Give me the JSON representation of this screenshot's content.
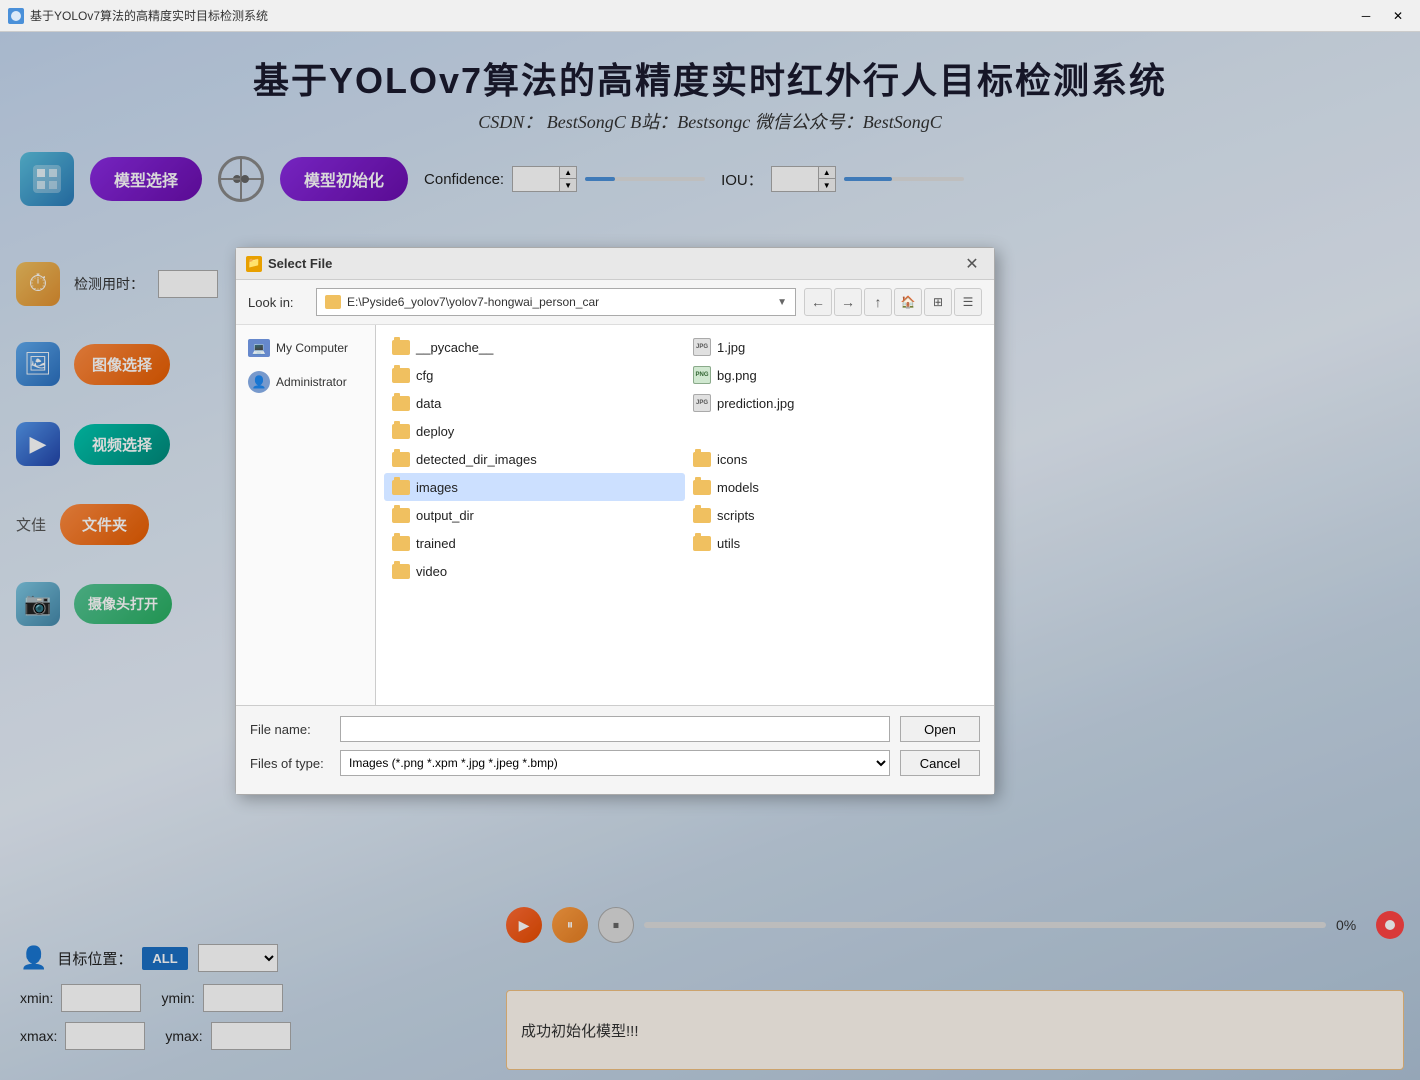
{
  "titleBar": {
    "title": "基于YOLOv7算法的高精度实时目标检测系统",
    "minimizeLabel": "─",
    "closeLabel": "✕"
  },
  "header": {
    "title": "基于YOLOv7算法的高精度实时红外行人目标检测系统",
    "subtitle": "CSDN： BestSongC    B站：Bestsongc    微信公众号：BestSongC"
  },
  "toolbar": {
    "modelSelectLabel": "模型选择",
    "modelInitLabel": "模型初始化",
    "confidenceLabel": "Confidence:",
    "confidenceValue": "0.25",
    "iouLabel": "IOU：",
    "iouValue": "0.40",
    "confidencePercent": 25,
    "iouPercent": 40
  },
  "sidebar": {
    "detectTimeLabel": "检测用时：",
    "imageSelectLabel": "图像选择",
    "videoSelectLabel": "视频选择",
    "folderLabel": "文件夹",
    "folderBtnLabel": "文件夹",
    "cameraLabel": "摄像头打开"
  },
  "targetPos": {
    "label": "目标位置：",
    "allLabel": "ALL",
    "xminLabel": "xmin:",
    "yminLabel": "ymin:",
    "xmaxLabel": "xmax:",
    "ymaxLabel": "ymax:"
  },
  "progressBar": {
    "percent": "0%"
  },
  "statusBar": {
    "message": "成功初始化模型!!!"
  },
  "fileDialog": {
    "title": "Select File",
    "lookInLabel": "Look in:",
    "lookInPath": "E:\\Pyside6_yolov7\\yolov7-hongwai_person_car",
    "places": [
      {
        "name": "My Computer",
        "type": "computer"
      },
      {
        "name": "Administrator",
        "type": "user"
      }
    ],
    "files": [
      {
        "name": "__pycache__",
        "type": "folder"
      },
      {
        "name": "1.jpg",
        "type": "jpg"
      },
      {
        "name": "cfg",
        "type": "folder"
      },
      {
        "name": "bg.png",
        "type": "png"
      },
      {
        "name": "data",
        "type": "folder"
      },
      {
        "name": "prediction.jpg",
        "type": "jpg"
      },
      {
        "name": "deploy",
        "type": "folder"
      },
      {
        "name": "detected_dir_images",
        "type": "folder"
      },
      {
        "name": "icons",
        "type": "folder"
      },
      {
        "name": "images",
        "type": "folder",
        "selected": true
      },
      {
        "name": "models",
        "type": "folder"
      },
      {
        "name": "output_dir",
        "type": "folder"
      },
      {
        "name": "scripts",
        "type": "folder"
      },
      {
        "name": "trained",
        "type": "folder"
      },
      {
        "name": "utils",
        "type": "folder"
      },
      {
        "name": "video",
        "type": "folder"
      }
    ],
    "fileNameLabel": "File name:",
    "fileNameValue": "",
    "fileNamePlaceholder": "",
    "filesOfTypeLabel": "Files of type:",
    "filesOfTypeValue": "Images (*.png *.xpm *.jpg *.jpeg *.bmp)",
    "openLabel": "Open",
    "cancelLabel": "Cancel"
  }
}
